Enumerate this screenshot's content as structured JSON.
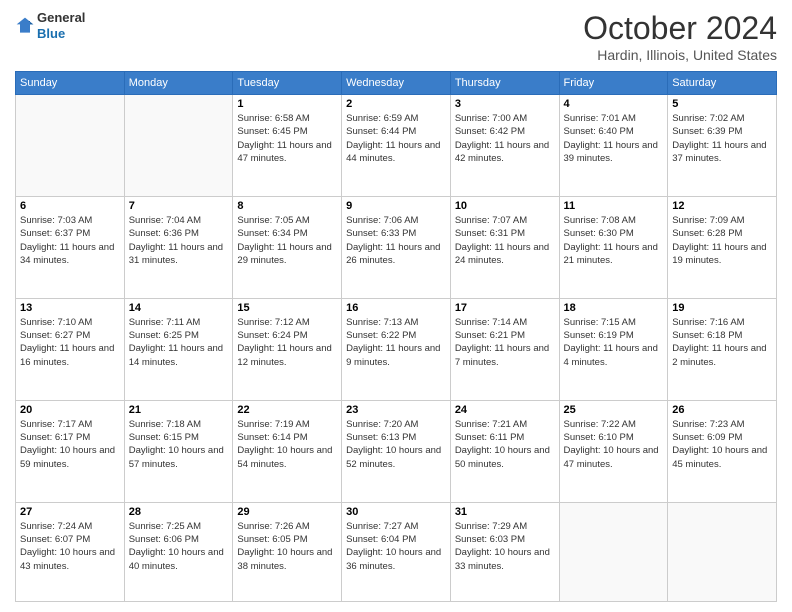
{
  "header": {
    "logo_line1": "General",
    "logo_line2": "Blue",
    "month_title": "October 2024",
    "location": "Hardin, Illinois, United States"
  },
  "weekdays": [
    "Sunday",
    "Monday",
    "Tuesday",
    "Wednesday",
    "Thursday",
    "Friday",
    "Saturday"
  ],
  "weeks": [
    [
      {
        "day": "",
        "info": ""
      },
      {
        "day": "",
        "info": ""
      },
      {
        "day": "1",
        "info": "Sunrise: 6:58 AM\nSunset: 6:45 PM\nDaylight: 11 hours and 47 minutes."
      },
      {
        "day": "2",
        "info": "Sunrise: 6:59 AM\nSunset: 6:44 PM\nDaylight: 11 hours and 44 minutes."
      },
      {
        "day": "3",
        "info": "Sunrise: 7:00 AM\nSunset: 6:42 PM\nDaylight: 11 hours and 42 minutes."
      },
      {
        "day": "4",
        "info": "Sunrise: 7:01 AM\nSunset: 6:40 PM\nDaylight: 11 hours and 39 minutes."
      },
      {
        "day": "5",
        "info": "Sunrise: 7:02 AM\nSunset: 6:39 PM\nDaylight: 11 hours and 37 minutes."
      }
    ],
    [
      {
        "day": "6",
        "info": "Sunrise: 7:03 AM\nSunset: 6:37 PM\nDaylight: 11 hours and 34 minutes."
      },
      {
        "day": "7",
        "info": "Sunrise: 7:04 AM\nSunset: 6:36 PM\nDaylight: 11 hours and 31 minutes."
      },
      {
        "day": "8",
        "info": "Sunrise: 7:05 AM\nSunset: 6:34 PM\nDaylight: 11 hours and 29 minutes."
      },
      {
        "day": "9",
        "info": "Sunrise: 7:06 AM\nSunset: 6:33 PM\nDaylight: 11 hours and 26 minutes."
      },
      {
        "day": "10",
        "info": "Sunrise: 7:07 AM\nSunset: 6:31 PM\nDaylight: 11 hours and 24 minutes."
      },
      {
        "day": "11",
        "info": "Sunrise: 7:08 AM\nSunset: 6:30 PM\nDaylight: 11 hours and 21 minutes."
      },
      {
        "day": "12",
        "info": "Sunrise: 7:09 AM\nSunset: 6:28 PM\nDaylight: 11 hours and 19 minutes."
      }
    ],
    [
      {
        "day": "13",
        "info": "Sunrise: 7:10 AM\nSunset: 6:27 PM\nDaylight: 11 hours and 16 minutes."
      },
      {
        "day": "14",
        "info": "Sunrise: 7:11 AM\nSunset: 6:25 PM\nDaylight: 11 hours and 14 minutes."
      },
      {
        "day": "15",
        "info": "Sunrise: 7:12 AM\nSunset: 6:24 PM\nDaylight: 11 hours and 12 minutes."
      },
      {
        "day": "16",
        "info": "Sunrise: 7:13 AM\nSunset: 6:22 PM\nDaylight: 11 hours and 9 minutes."
      },
      {
        "day": "17",
        "info": "Sunrise: 7:14 AM\nSunset: 6:21 PM\nDaylight: 11 hours and 7 minutes."
      },
      {
        "day": "18",
        "info": "Sunrise: 7:15 AM\nSunset: 6:19 PM\nDaylight: 11 hours and 4 minutes."
      },
      {
        "day": "19",
        "info": "Sunrise: 7:16 AM\nSunset: 6:18 PM\nDaylight: 11 hours and 2 minutes."
      }
    ],
    [
      {
        "day": "20",
        "info": "Sunrise: 7:17 AM\nSunset: 6:17 PM\nDaylight: 10 hours and 59 minutes."
      },
      {
        "day": "21",
        "info": "Sunrise: 7:18 AM\nSunset: 6:15 PM\nDaylight: 10 hours and 57 minutes."
      },
      {
        "day": "22",
        "info": "Sunrise: 7:19 AM\nSunset: 6:14 PM\nDaylight: 10 hours and 54 minutes."
      },
      {
        "day": "23",
        "info": "Sunrise: 7:20 AM\nSunset: 6:13 PM\nDaylight: 10 hours and 52 minutes."
      },
      {
        "day": "24",
        "info": "Sunrise: 7:21 AM\nSunset: 6:11 PM\nDaylight: 10 hours and 50 minutes."
      },
      {
        "day": "25",
        "info": "Sunrise: 7:22 AM\nSunset: 6:10 PM\nDaylight: 10 hours and 47 minutes."
      },
      {
        "day": "26",
        "info": "Sunrise: 7:23 AM\nSunset: 6:09 PM\nDaylight: 10 hours and 45 minutes."
      }
    ],
    [
      {
        "day": "27",
        "info": "Sunrise: 7:24 AM\nSunset: 6:07 PM\nDaylight: 10 hours and 43 minutes."
      },
      {
        "day": "28",
        "info": "Sunrise: 7:25 AM\nSunset: 6:06 PM\nDaylight: 10 hours and 40 minutes."
      },
      {
        "day": "29",
        "info": "Sunrise: 7:26 AM\nSunset: 6:05 PM\nDaylight: 10 hours and 38 minutes."
      },
      {
        "day": "30",
        "info": "Sunrise: 7:27 AM\nSunset: 6:04 PM\nDaylight: 10 hours and 36 minutes."
      },
      {
        "day": "31",
        "info": "Sunrise: 7:29 AM\nSunset: 6:03 PM\nDaylight: 10 hours and 33 minutes."
      },
      {
        "day": "",
        "info": ""
      },
      {
        "day": "",
        "info": ""
      }
    ]
  ]
}
